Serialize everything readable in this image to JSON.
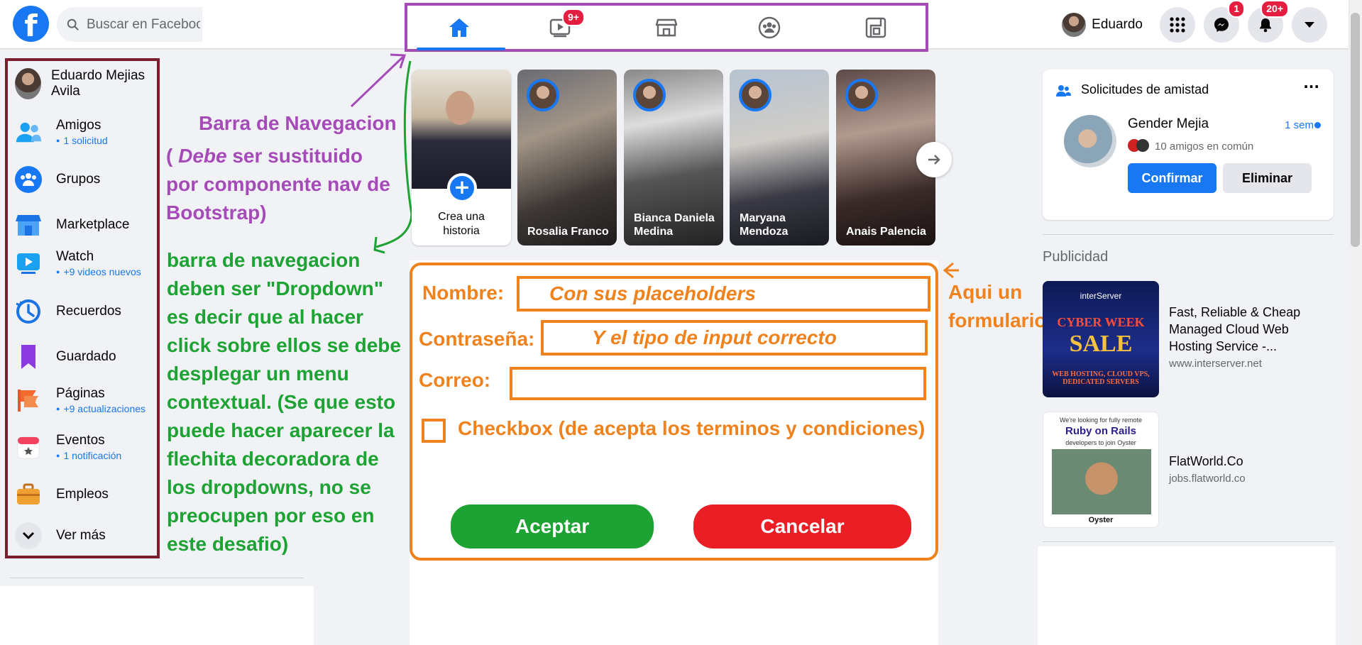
{
  "header": {
    "logo_letter": "f",
    "search_placeholder": "Buscar en Facebook",
    "nav_badges": {
      "watch": "9+"
    },
    "user_name": "Eduardo",
    "messenger_badge": "1",
    "notifications_badge": "20+"
  },
  "sidebar": {
    "profile_name": "Eduardo Mejias Avila",
    "items": [
      {
        "label": "Amigos",
        "sub": "1 solicitud"
      },
      {
        "label": "Grupos",
        "sub": ""
      },
      {
        "label": "Marketplace",
        "sub": ""
      },
      {
        "label": "Watch",
        "sub": "+9 videos nuevos"
      },
      {
        "label": "Recuerdos",
        "sub": ""
      },
      {
        "label": "Guardado",
        "sub": ""
      },
      {
        "label": "Páginas",
        "sub": "+9 actualizaciones"
      },
      {
        "label": "Eventos",
        "sub": "1 notificación"
      },
      {
        "label": "Empleos",
        "sub": ""
      },
      {
        "label": "Ver más",
        "sub": ""
      }
    ]
  },
  "annotations": {
    "nav_title": "Barra de Navegacion",
    "nav_line1_open": "( ",
    "nav_line1_debe": "Debe",
    "nav_line1_rest": " ser sustituido",
    "nav_line2": "por componente nav de",
    "nav_line3": "Bootstrap)",
    "dropdown_lines": [
      "barra de navegacion",
      "deben ser \"Dropdown\"",
      "es decir que al hacer",
      "click sobre ellos se debe",
      "desplegar un menu",
      "contextual. (Se que esto",
      "puede hacer aparecer la",
      "flechita decoradora de",
      "los dropdowns, no se",
      "preocupen por eso en",
      "este desafio)"
    ],
    "form_note_line1": "Aqui un",
    "form_note_line2": "formulario"
  },
  "stories": [
    {
      "name": "Crea una historia"
    },
    {
      "name": "Rosalia Franco"
    },
    {
      "name": "Bianca Daniela Medina"
    },
    {
      "name": "Maryana Mendoza"
    },
    {
      "name": "Anais Palencia"
    }
  ],
  "form": {
    "name_label": "Nombre:",
    "name_placeholder": "Con sus placeholders",
    "password_label": "Contraseña:",
    "password_placeholder": "Y el tipo de input correcto",
    "email_label": "Correo:",
    "email_placeholder": "",
    "checkbox_label": "Checkbox (de acepta los terminos y condiciones)",
    "accept_label": "Aceptar",
    "cancel_label": "Cancelar",
    "accept_color": "#1da333",
    "cancel_color": "#ea1f25"
  },
  "friend_requests": {
    "title": "Solicitudes de amistad",
    "more": "···",
    "name": "Gender Mejia",
    "time": "1 sem",
    "mutual": "10 amigos en común",
    "confirm_label": "Confirmar",
    "delete_label": "Eliminar"
  },
  "ads": {
    "section_title": "Publicidad",
    "items": [
      {
        "title": "Fast, Reliable & Cheap Managed Cloud Web Hosting Service -...",
        "url": "www.interserver.net",
        "img_brand": "interServer",
        "img_headline_1": "CYBER WEEK",
        "img_headline_2": "SALE",
        "img_tagline": "WEB HOSTING, CLOUD VPS, DEDICATED SERVERS"
      },
      {
        "title": "FlatWorld.Co",
        "url": "jobs.flatworld.co",
        "img_pre": "We're looking for fully remote",
        "img_headline": "Ruby on Rails",
        "img_sub": "developers to join Oyster",
        "img_brand": "Oyster"
      }
    ]
  },
  "colors": {
    "brand": "#1877f2",
    "annotation_purple": "#a54bb8",
    "annotation_green": "#1da333",
    "annotation_orange": "#f0821e",
    "sidebar_frame": "#7a1d2e"
  }
}
